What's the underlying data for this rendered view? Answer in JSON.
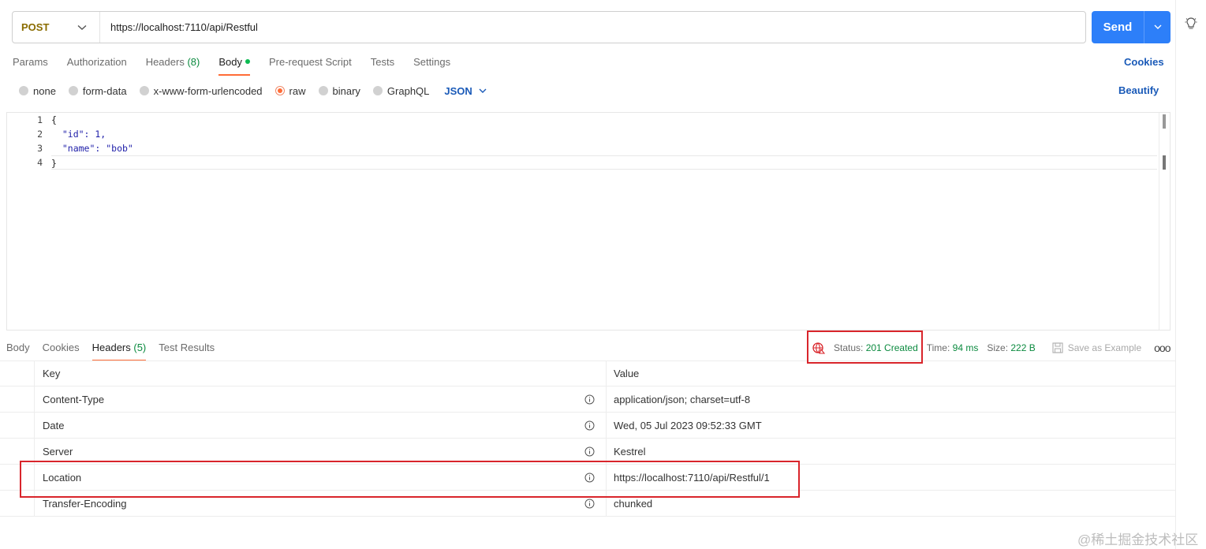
{
  "request": {
    "method": "POST",
    "url": "https://localhost:7110/api/Restful",
    "send_label": "Send"
  },
  "request_tabs": [
    {
      "label": "Params"
    },
    {
      "label": "Authorization"
    },
    {
      "label": "Headers",
      "count": "(8)"
    },
    {
      "label": "Body",
      "active": true
    },
    {
      "label": "Pre-request Script"
    },
    {
      "label": "Tests"
    },
    {
      "label": "Settings"
    }
  ],
  "cookies_link": "Cookies",
  "body_types": [
    "none",
    "form-data",
    "x-www-form-urlencoded",
    "raw",
    "binary",
    "GraphQL"
  ],
  "body_type_selected": "raw",
  "format": "JSON",
  "beautify_label": "Beautify",
  "editor": {
    "line_numbers": [
      "1",
      "2",
      "3",
      "4"
    ],
    "lines": [
      "{",
      "  \"id\": 1,",
      "  \"name\": \"bob\"",
      "}"
    ]
  },
  "response_tabs": [
    {
      "label": "Body"
    },
    {
      "label": "Cookies"
    },
    {
      "label": "Headers",
      "count": "(5)",
      "active": true
    },
    {
      "label": "Test Results"
    }
  ],
  "response_meta": {
    "status_label": "Status:",
    "status_value": "201 Created",
    "time_label": "Time:",
    "time_value": "94 ms",
    "size_label": "Size:",
    "size_value": "222 B",
    "save_example": "Save as Example",
    "more": "ooo"
  },
  "headers_table": {
    "columns": [
      "Key",
      "Value"
    ],
    "rows": [
      {
        "key": "Content-Type",
        "value": "application/json; charset=utf-8"
      },
      {
        "key": "Date",
        "value": "Wed, 05 Jul 2023 09:52:33 GMT"
      },
      {
        "key": "Server",
        "value": "Kestrel"
      },
      {
        "key": "Location",
        "value": "https://localhost:7110/api/Restful/1"
      },
      {
        "key": "Transfer-Encoding",
        "value": "chunked"
      }
    ]
  },
  "watermark": "@稀土掘金技术社区",
  "colors": {
    "accent": "#ff6c37",
    "send": "#2d7ff9",
    "success": "#0b8a3f",
    "link": "#1a5ab8",
    "highlight": "#d9252b"
  }
}
